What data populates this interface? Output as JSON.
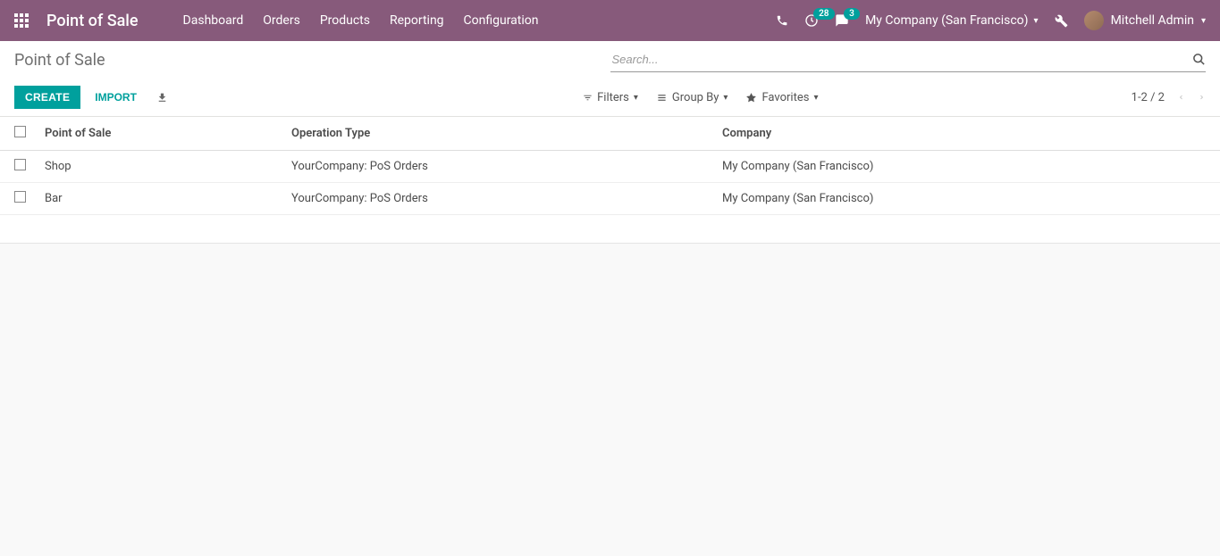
{
  "navbar": {
    "brand": "Point of Sale",
    "menu": [
      "Dashboard",
      "Orders",
      "Products",
      "Reporting",
      "Configuration"
    ],
    "activities_count": "28",
    "messages_count": "3",
    "company": "My Company (San Francisco)",
    "user": "Mitchell Admin"
  },
  "control_panel": {
    "title": "Point of Sale",
    "search_placeholder": "Search...",
    "create_label": "CREATE",
    "import_label": "IMPORT",
    "filters_label": "Filters",
    "groupby_label": "Group By",
    "favorites_label": "Favorites",
    "pager": "1-2 / 2"
  },
  "table": {
    "headers": {
      "pos": "Point of Sale",
      "op": "Operation Type",
      "company": "Company"
    },
    "rows": [
      {
        "pos": "Shop",
        "op": "YourCompany: PoS Orders",
        "company": "My Company (San Francisco)"
      },
      {
        "pos": "Bar",
        "op": "YourCompany: PoS Orders",
        "company": "My Company (San Francisco)"
      }
    ]
  }
}
